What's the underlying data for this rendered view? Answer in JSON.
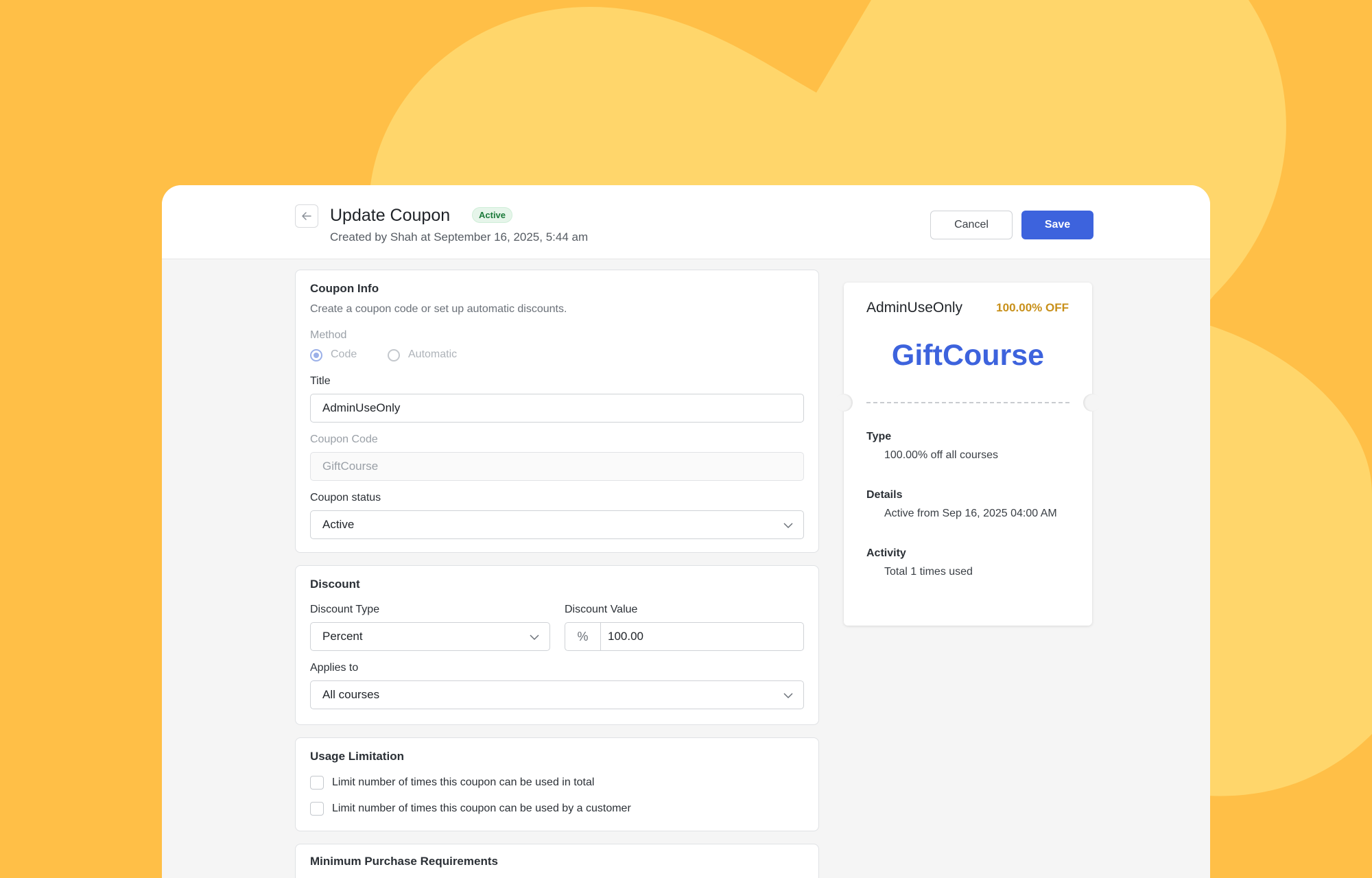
{
  "header": {
    "title": "Update Coupon",
    "status_badge": "Active",
    "created_by": "Created by Shah at September 16, 2025, 5:44 am",
    "cancel_label": "Cancel",
    "save_label": "Save"
  },
  "coupon_info": {
    "title": "Coupon Info",
    "subtitle": "Create a coupon code or set up automatic discounts.",
    "method_label": "Method",
    "method_options": [
      "Code",
      "Automatic"
    ],
    "method_selected": "Code",
    "title_label": "Title",
    "title_value": "AdminUseOnly",
    "code_label": "Coupon Code",
    "code_value": "GiftCourse",
    "status_label": "Coupon status",
    "status_value": "Active"
  },
  "discount": {
    "title": "Discount",
    "type_label": "Discount Type",
    "type_value": "Percent",
    "value_label": "Discount Value",
    "value_prefix": "%",
    "value_value": "100.00",
    "applies_label": "Applies to",
    "applies_value": "All courses"
  },
  "usage": {
    "title": "Usage Limitation",
    "options": [
      "Limit number of times this coupon can be used in total",
      "Limit number of times this coupon can be used by a customer"
    ]
  },
  "minimum": {
    "title": "Minimum Purchase Requirements"
  },
  "ticket": {
    "title": "AdminUseOnly",
    "off": "100.00% OFF",
    "code": "GiftCourse",
    "type_label": "Type",
    "type_value": "100.00% off all courses",
    "details_label": "Details",
    "details_value": "Active from Sep 16, 2025 04:00 AM",
    "activity_label": "Activity",
    "activity_value": "Total 1 times used"
  },
  "colors": {
    "background": "#FFBF47",
    "blob": "#FFD66B",
    "accent": "#3D63DD",
    "badge_green": "#1B7A3A",
    "off_gold": "#C8901A"
  }
}
